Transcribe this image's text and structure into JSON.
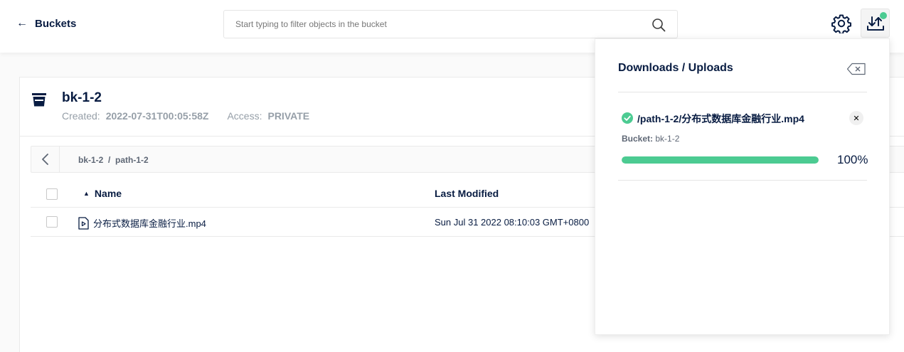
{
  "topbar": {
    "back_label": "Buckets",
    "search_placeholder": "Start typing to filter objects in the bucket"
  },
  "bucket": {
    "name": "bk-1-2",
    "created_label": "Created:",
    "created_value": "2022-07-31T00:05:58Z",
    "access_label": "Access:",
    "access_value": "PRIVATE",
    "breadcrumb": "bk-1-2  /  path-1-2"
  },
  "table": {
    "columns": [
      "Name",
      "Last Modified"
    ],
    "rows": [
      {
        "name": "分布式数据库金融行业.mp4",
        "modified": "Sun Jul 31 2022 08:10:03 GMT+0800"
      }
    ]
  },
  "panel": {
    "title": "Downloads / Uploads",
    "items": [
      {
        "path": "/path-1-2/分布式数据库金融行业.mp4",
        "bucket_label": "Bucket:",
        "bucket_value": "bk-1-2",
        "progress": 100,
        "progress_text": "100%"
      }
    ]
  },
  "colors": {
    "accent": "#4ccb92",
    "text": "#081c42",
    "muted": "#969fa8"
  },
  "icons": [
    "back-arrow-icon",
    "search-icon",
    "gear-icon",
    "download-upload-icon",
    "bucket-icon",
    "chevron-left-icon",
    "sort-ascending-icon",
    "video-file-icon",
    "backspace-clear-icon",
    "check-circle-icon",
    "close-icon"
  ]
}
